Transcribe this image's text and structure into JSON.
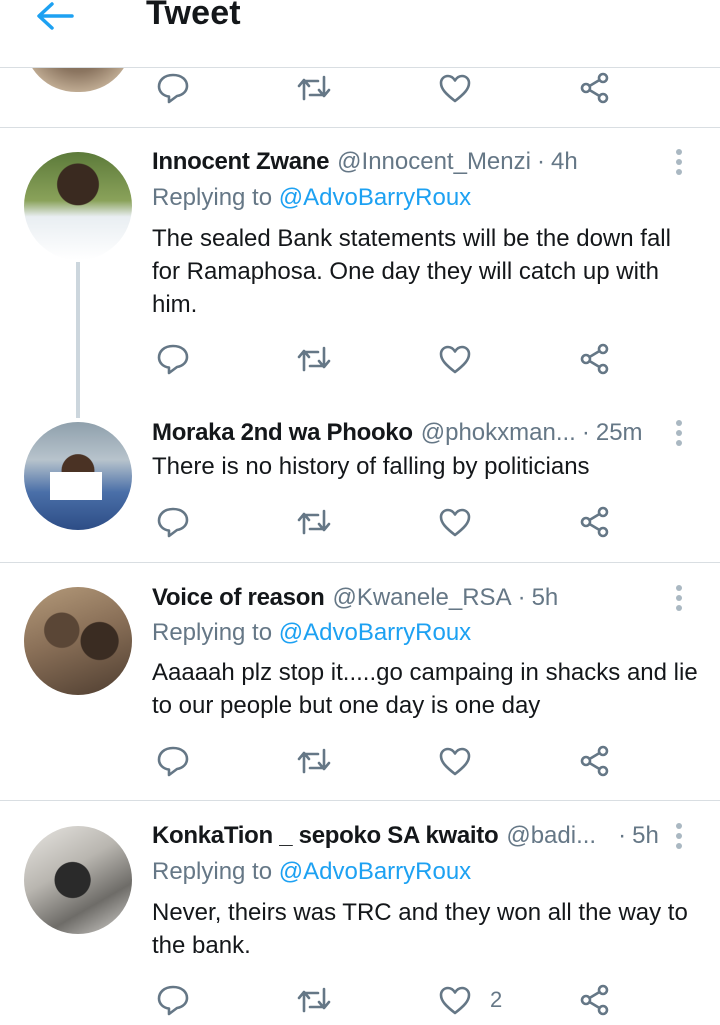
{
  "header": {
    "title": "Tweet",
    "back_icon": "arrow-left-icon",
    "accent": "#1da1f2"
  },
  "colors": {
    "secondary_text": "#657786",
    "divider": "#d9dee2",
    "thread_line": "#ccd6dd"
  },
  "replies": [
    {
      "name": "Innocent Zwane",
      "handle": "@Innocent_Menzi",
      "time": "4h",
      "replying_prefix": "Replying to",
      "replying_to": "@AdvoBarryRoux",
      "text": "The sealed Bank statements will be the down fall for Ramaphosa. One day they will catch up with him."
    },
    {
      "name": "Moraka 2nd wa Phooko",
      "handle": "@phokxman...",
      "time": "25m",
      "text": "There is no history of falling by politicians"
    },
    {
      "name": "Voice of reason",
      "handle": "@Kwanele_RSA",
      "time": "5h",
      "replying_prefix": "Replying to",
      "replying_to": "@AdvoBarryRoux",
      "text": "Aaaaah plz stop it.....go campaing in shacks and lie to our people but one day is one day"
    },
    {
      "name": "KonkaTion _ sepoko SA kwaito",
      "handle": "@badi...",
      "time": "5h",
      "replying_prefix": "Replying to",
      "replying_to": "@AdvoBarryRoux",
      "text": "Never, theirs was TRC and they won all the way to the bank.",
      "like_count": "2"
    }
  ],
  "separator": "·",
  "icons": {
    "reply": "reply-icon",
    "retweet": "retweet-icon",
    "like": "heart-icon",
    "share": "share-icon",
    "more": "more-vertical-icon"
  }
}
